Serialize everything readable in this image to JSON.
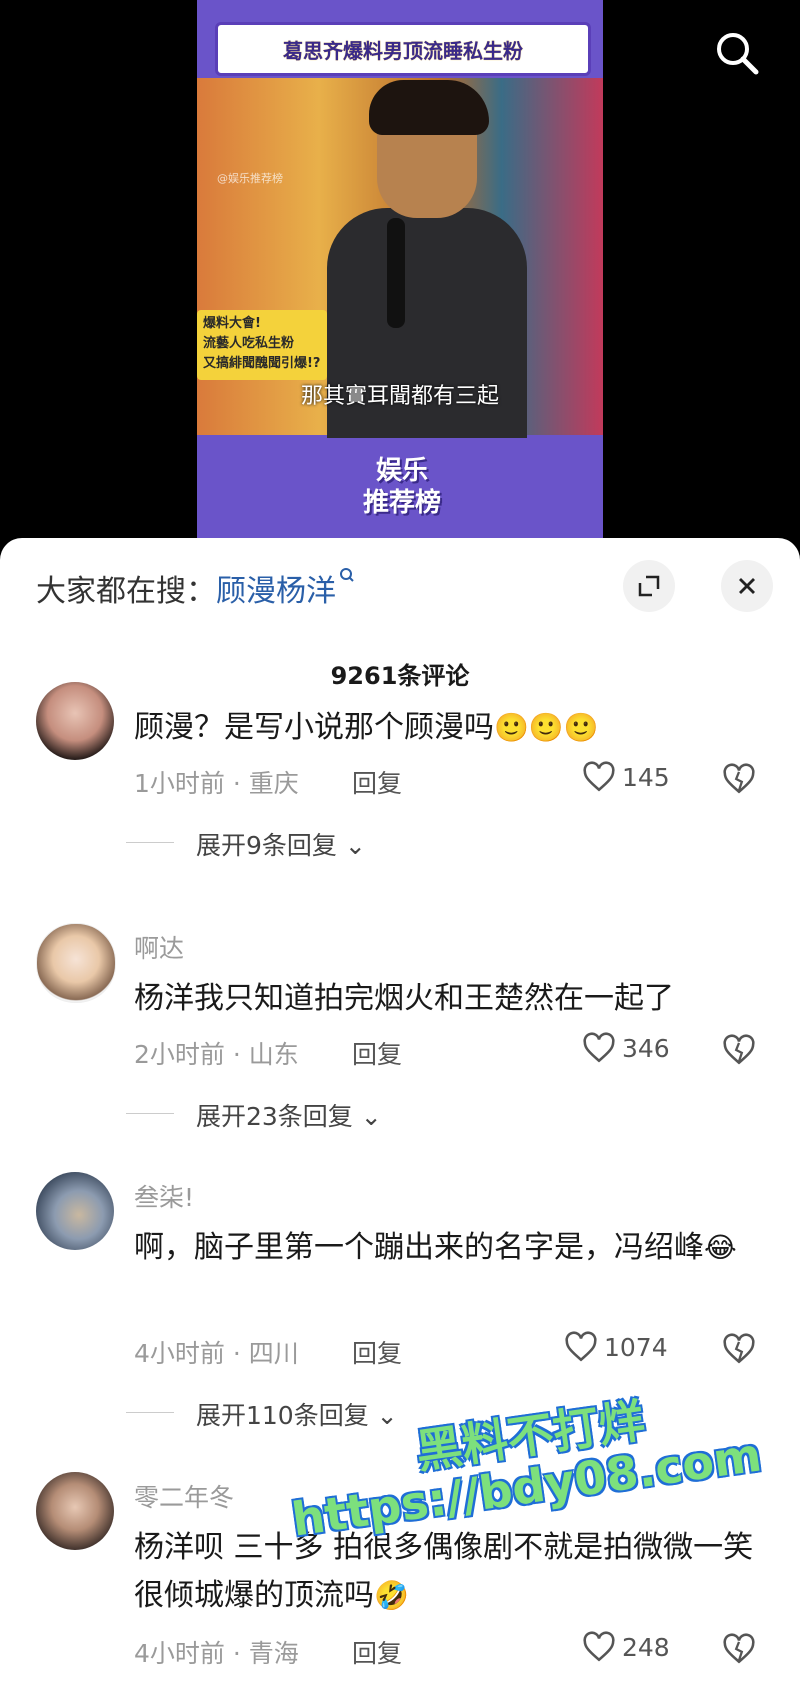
{
  "video": {
    "banner_title": "葛思齐爆料男顶流睡私生粉",
    "small_watermark": "@娱乐推荐榜",
    "badge_lines": [
      "爆料大會!",
      "流藝人吃私生粉",
      "又搞緋聞醜聞引爆!?"
    ],
    "subtitle": "那其實耳聞都有三起",
    "brand_line1": "娱乐",
    "brand_line2": "推荐榜"
  },
  "search_icon": "search-icon",
  "sheet": {
    "hot_search_label": "大家都在搜：",
    "hot_search_term": "顾漫杨洋",
    "comment_count": "9261条评论"
  },
  "comments": [
    {
      "name": "",
      "text": "顾漫？是写小说那个顾漫吗",
      "emoji": "🙂🙂🙂",
      "meta": "1小时前 · 重庆",
      "reply_label": "回复",
      "likes": "145",
      "expand_label": "展开9条回复"
    },
    {
      "name": "啊达",
      "text": "杨洋我只知道拍完烟火和王楚然在一起了",
      "emoji": "",
      "meta": "2小时前 · 山东",
      "reply_label": "回复",
      "likes": "346",
      "expand_label": "展开23条回复"
    },
    {
      "name": "叁柒!",
      "text": "啊，脑子里第一个蹦出来的名字是，冯绍峰",
      "emoji": "😂",
      "meta": "4小时前 · 四川",
      "reply_label": "回复",
      "likes": "1074",
      "expand_label": "展开110条回复"
    },
    {
      "name": "零二年冬",
      "text": "杨洋呗 三十多 拍很多偶像剧不就是拍微微一笑很倾城爆的顶流吗",
      "emoji": "🤣",
      "meta": "4小时前 · 青海",
      "reply_label": "回复",
      "likes": "248",
      "expand_label": ""
    }
  ],
  "watermark": {
    "line1": "黑料不打烊",
    "line2": "https://bdy08.com"
  }
}
